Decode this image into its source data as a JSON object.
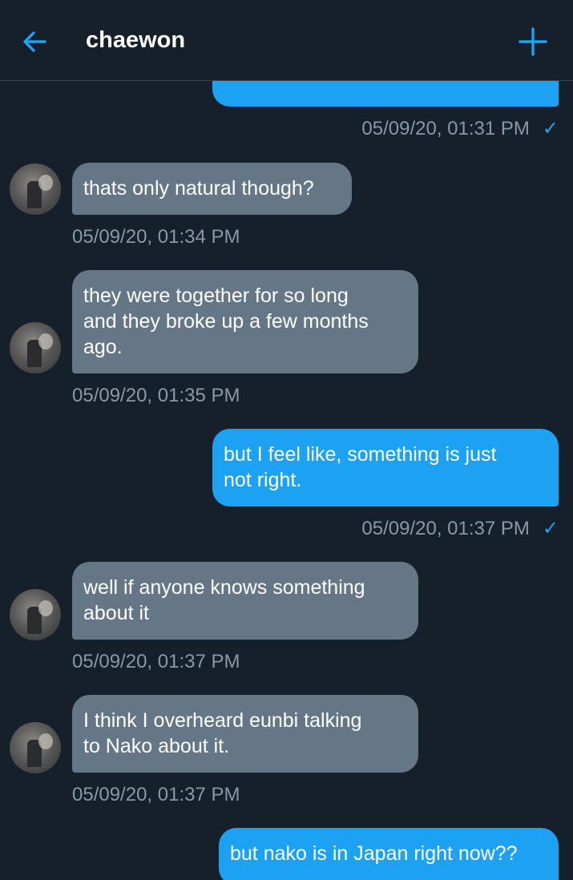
{
  "header": {
    "title": "chaewon"
  },
  "messages": [
    {
      "text": "thats only natural though?",
      "time": "05/09/20, 01:34 PM"
    },
    {
      "text": "they were together for so long\nand they broke up a few months\nago.",
      "time": "05/09/20, 01:35 PM"
    },
    {
      "text": "but I feel like, something is just\nnot right.",
      "time": "05/09/20, 01:37 PM",
      "status": "✓"
    },
    {
      "text": "well if anyone knows something\nabout it",
      "time": "05/09/20, 01:37 PM"
    },
    {
      "text": "I think I overheard eunbi talking\nto Nako about it.",
      "time": "05/09/20, 01:37 PM"
    },
    {
      "text": "but nako is in Japan right now??"
    }
  ],
  "top_partial": {
    "time": "05/09/20, 01:31 PM",
    "status": "✓"
  },
  "colors": {
    "sent": "#1da1f2",
    "received": "#657786",
    "background": "#15202b",
    "timestamp": "#8899a6"
  }
}
